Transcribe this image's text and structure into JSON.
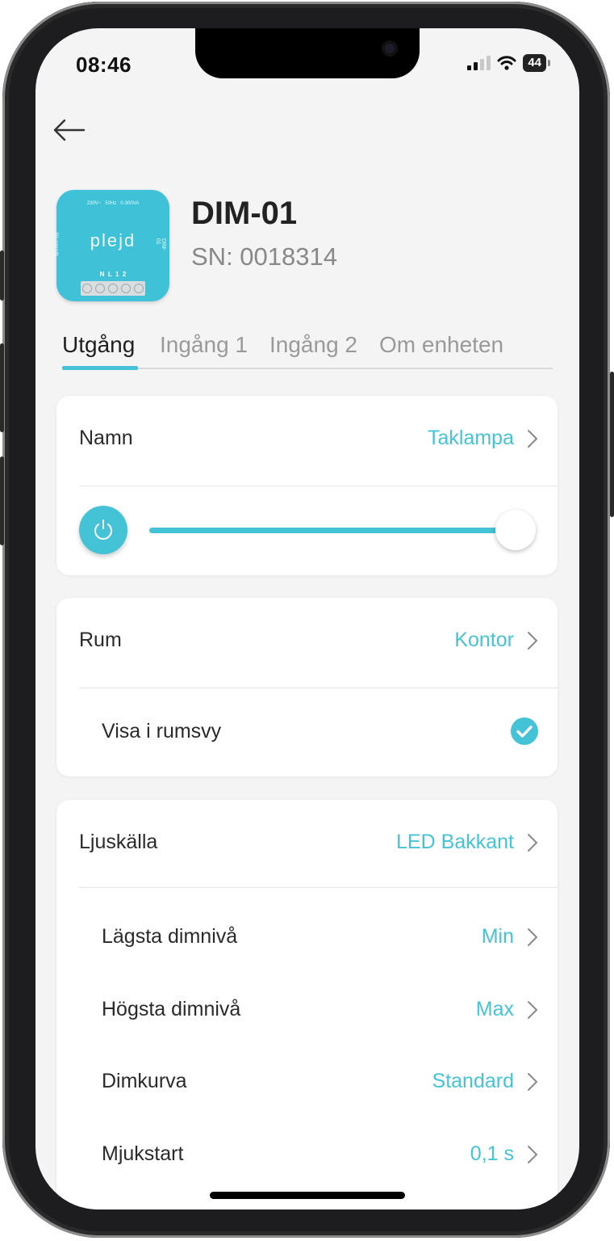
{
  "status_bar": {
    "time": "08:46",
    "battery": "44"
  },
  "device": {
    "name": "DIM-01",
    "serial": "SN: 0018314",
    "image": {
      "spec_label": "230V~   50Hz   0-300VA",
      "brand": "plejd",
      "side_left": "Bluetooth",
      "side_right": "DIM-01",
      "terminals": "N  L  1  2"
    }
  },
  "tabs": [
    "Utgång",
    "Ingång 1",
    "Ingång 2",
    "Om enheten"
  ],
  "output_card": {
    "name_label": "Namn",
    "name_value": "Taklampa",
    "brightness_fraction": 1.0
  },
  "room_card": {
    "room_label": "Rum",
    "room_value": "Kontor",
    "show_label": "Visa i rumsvy",
    "show_checked": true
  },
  "light_card": {
    "source_label": "Ljuskälla",
    "source_value": "LED Bakkant",
    "rows": [
      {
        "label": "Lägsta dimnivå",
        "value": "Min"
      },
      {
        "label": "Högsta dimnivå",
        "value": "Max"
      },
      {
        "label": "Dimkurva",
        "value": "Standard"
      },
      {
        "label": "Mjukstart",
        "value": "0,1 s"
      }
    ]
  },
  "colors": {
    "accent": "#45c3d6",
    "text": "#2a2a2a",
    "muted": "#888888"
  }
}
